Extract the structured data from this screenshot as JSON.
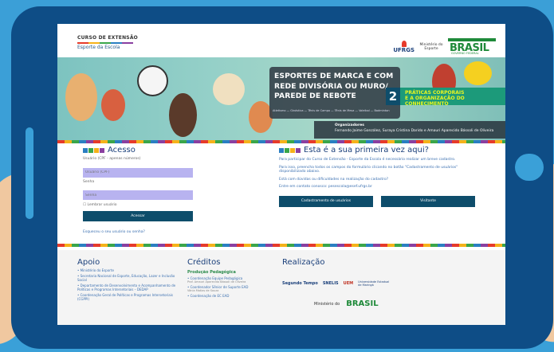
{
  "header": {
    "course_label": "CURSO DE EXTENSÃO",
    "course_name": "Esporte da Escola",
    "ufrgs": "UFRGS",
    "ministry": "Ministério do Esporte",
    "brasil": "BRASIL",
    "brasil_sub": "GOVERNO FEDERAL"
  },
  "banner": {
    "title_line1": "ESPORTES DE MARCA E COM",
    "title_line2": "REDE DIVISÓRIA OU MURO/",
    "title_line3": "PAREDE DE REBOTE",
    "number": "2",
    "green_line1": "PRÁTICAS CORPORAIS",
    "green_line2": "E A ORGANIZAÇÃO DO CONHECIMENTO",
    "nav": "Atletismo — Ginástica — Tênis de Campo — Tênis de Mesa — Voleibol — Badminton",
    "orgs_heading": "Organizadores",
    "orgs_names": "Fernando Jaime González, Suraya Cristina Darido e Amauri Aparecido Bássoli de Oliveira"
  },
  "login": {
    "title": "Acesso",
    "user_label": "Usuário (CPF - apenas números)",
    "user_placeholder": "Usuário (CPF)",
    "password_label": "Senha",
    "password_placeholder": "Senha",
    "remember": "Lembrar usuário",
    "submit": "Acessar",
    "forgot": "Esqueceu o seu usuário ou senha?"
  },
  "first_time": {
    "title": "Esta é a sua primeira vez aqui?",
    "p1": "Para participar do Curso de Extensão - Esporte da Escola é necessário realizar um breve cadastro.",
    "p2": "Para isso, preencha todos os campos do formulário clicando no botão \"Cadastramento de usuários\" disponibilizado abaixo.",
    "p3": "Está com dúvidas ou dificuldades na realização do cadastro?",
    "p4": "Entre em contato conosco: pesescola@esef.ufrgs.br",
    "register_button": "Cadastramento de usuários",
    "visitor_button": "Visitante"
  },
  "footer": {
    "apoio_title": "Apoio",
    "apoio_items": [
      "• Ministério do Esporte",
      "• Secretaria Nacional de Esporte, Educação, Lazer e Inclusão Social",
      "• Departamento de Desenvolvimento e Acompanhamento de Políticas e Programas Intersetoriais – DEDAP",
      "• Coordenação Geral de Políticas e Programas Intersetoriais (CGPPI)"
    ],
    "creditos_title": "Créditos",
    "creditos_sub": "Produção Pedagógica",
    "creditos_items": [
      "• Coordenação Equipe Pedagógica",
      "Prof. Amauri Aparecido Bássoli de Oliveira",
      "• Coordenador Sênior de Suporte EAD",
      "Vânia Matias de Souza",
      "• Coordenação de EC EAD"
    ],
    "realizacao_title": "Realização",
    "realizacao_logos": [
      "Segundo Tempo",
      "SNELIS",
      "UEM",
      "Universidade Estadual de Maringá",
      "Ministério do",
      "BRASIL"
    ]
  }
}
